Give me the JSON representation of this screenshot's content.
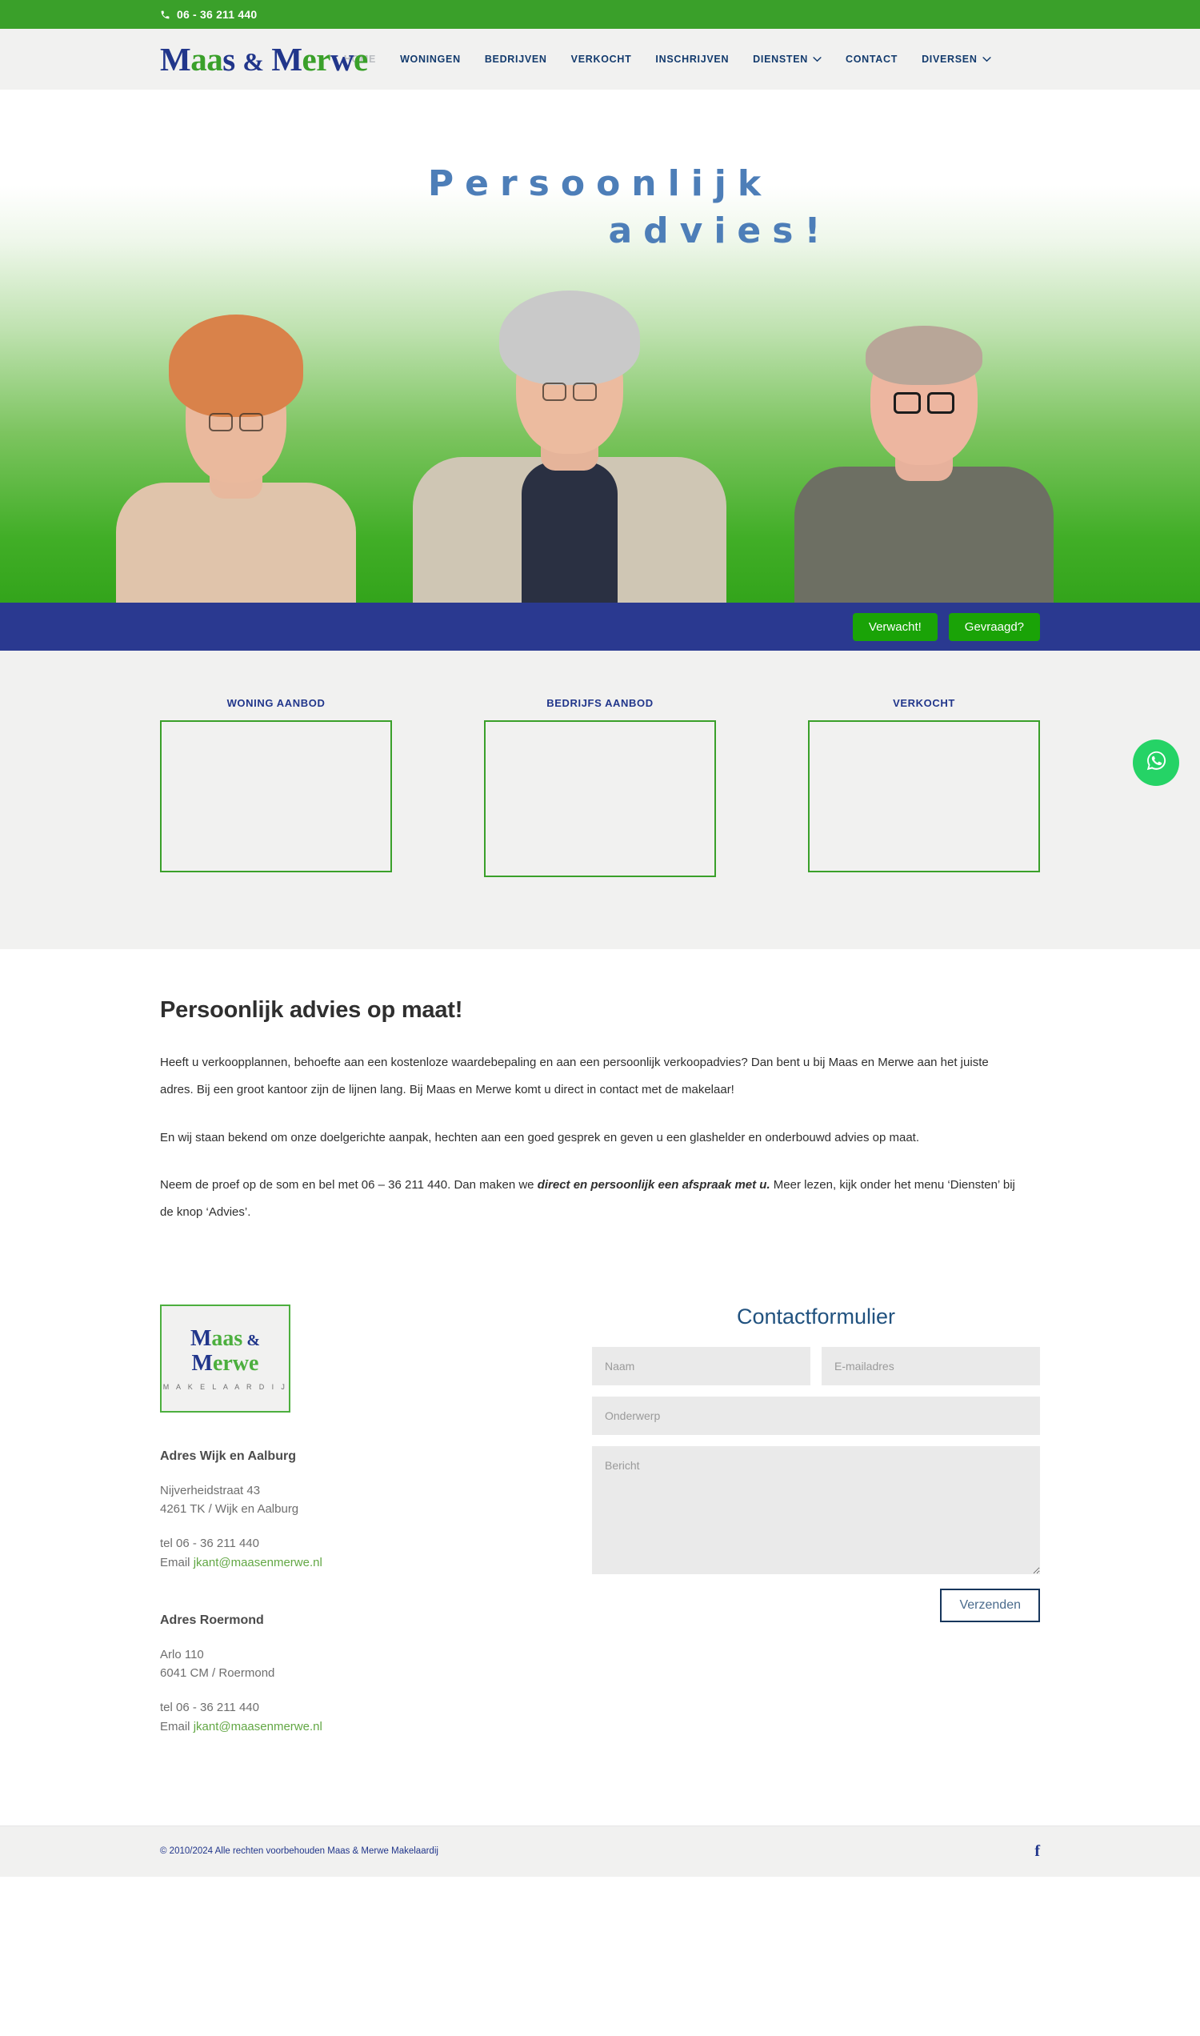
{
  "topbar": {
    "phone": "06 - 36 211 440",
    "phone_icon": "phone-icon"
  },
  "header": {
    "logo": {
      "part1": "Maas",
      "amp": "&",
      "part2": "Merwe"
    },
    "nav": [
      {
        "label": "HOME",
        "has_chevron": false,
        "muted": true
      },
      {
        "label": "WONINGEN",
        "has_chevron": false,
        "muted": false
      },
      {
        "label": "BEDRIJVEN",
        "has_chevron": false,
        "muted": false
      },
      {
        "label": "VERKOCHT",
        "has_chevron": false,
        "muted": false
      },
      {
        "label": "INSCHRIJVEN",
        "has_chevron": false,
        "muted": false
      },
      {
        "label": "DIENSTEN",
        "has_chevron": true,
        "muted": false
      },
      {
        "label": "CONTACT",
        "has_chevron": false,
        "muted": false
      },
      {
        "label": "DIVERSEN",
        "has_chevron": true,
        "muted": false
      }
    ]
  },
  "hero": {
    "title_line1": "Persoonlijk",
    "title_line2": "advies!",
    "title_color": "#4d7eb8"
  },
  "actionbar": {
    "buttons": [
      {
        "label": "Verwacht!"
      },
      {
        "label": "Gevraagd?"
      }
    ],
    "bg": "#2a3990",
    "button_bg": "#1aa307"
  },
  "boxes": [
    {
      "title": "WONING AANBOD"
    },
    {
      "title": "BEDRIJFS AANBOD"
    },
    {
      "title": "VERKOCHT"
    }
  ],
  "main": {
    "heading": "Persoonlijk advies op maat!",
    "p1": "Heeft u verkoopplannen, behoefte aan een kostenloze waardebepaling en aan een persoonlijk verkoopadvies? Dan bent u bij Maas en Merwe aan het juiste adres. Bij een groot kantoor zijn de lijnen lang. Bij Maas en Merwe komt u direct in contact met de makelaar!",
    "p2": "En wij staan bekend om onze doelgerichte aanpak, hechten aan een goed gesprek en geven u een glashelder en onderbouwd advies op maat.",
    "p3_a": "Neem de proef op de som en  bel met 06 – 36 211 440. Dan maken we ",
    "p3_b": "direct en persoonlijk een afspraak met u.",
    "p3_c": " Meer lezen, kijk onder het menu ‘Diensten’ bij de knop ‘Advies’."
  },
  "footer": {
    "logo": {
      "l1a": "Maas",
      "l1b": "&",
      "l2a": "M",
      "l2b": "erwe",
      "sub": "M A K E L A A R D I J"
    },
    "addresses": [
      {
        "title": "Adres Wijk en Aalburg",
        "street": "Nijverheidstraat 43",
        "city": "4261 TK / Wijk en Aalburg",
        "tel": "tel 06 - 36 211 440",
        "email_label": "Email ",
        "email": "jkant@maasenmerwe.nl"
      },
      {
        "title": "Adres Roermond",
        "street": "Arlo 110",
        "city": "6041 CM / Roermond",
        "tel": "tel 06 - 36 211 440",
        "email_label": "Email ",
        "email": "jkant@maasenmerwe.nl"
      }
    ]
  },
  "form": {
    "title": "Contactformulier",
    "name_placeholder": "Naam",
    "email_placeholder": "E-mailadres",
    "subject_placeholder": "Onderwerp",
    "message_placeholder": "Bericht",
    "submit_label": "Verzenden"
  },
  "bottombar": {
    "copyright": "© 2010/2024 Alle rechten voorbehouden Maas & Merwe Makelaardij",
    "facebook": "f"
  },
  "fab": {
    "name": "whatsapp-button",
    "color": "#25d366"
  }
}
